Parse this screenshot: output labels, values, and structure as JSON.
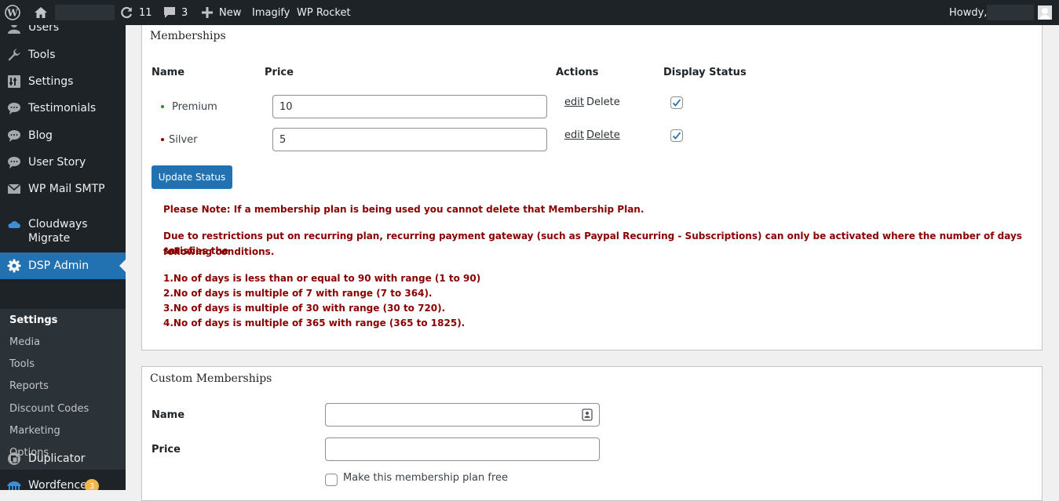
{
  "adminbar": {
    "updates_count": "11",
    "comments_count": "3",
    "new_label": "New",
    "imagify_label": "Imagify",
    "wp_rocket_label": "WP Rocket",
    "howdy_label": "Howdy,"
  },
  "sidebar": {
    "items": [
      {
        "label": "Users",
        "icon": "users-icon"
      },
      {
        "label": "Tools",
        "icon": "wrench-icon"
      },
      {
        "label": "Settings",
        "icon": "settings-icon"
      },
      {
        "label": "Testimonials",
        "icon": "comment-icon"
      },
      {
        "label": "Blog",
        "icon": "comment-icon"
      },
      {
        "label": "User Story",
        "icon": "comment-icon"
      },
      {
        "label": "WP Mail SMTP",
        "icon": "mail-icon"
      },
      {
        "label": "Cloudways",
        "label2": "Migrate",
        "icon": "cloud-icon"
      },
      {
        "label": "DSP Admin",
        "icon": "gear-icon"
      },
      {
        "label": "Duplicator",
        "icon": "duplicator-icon"
      },
      {
        "label": "Wordfence",
        "icon": "wordfence-icon",
        "badge": "3"
      }
    ],
    "submenu": [
      "Settings",
      "Media",
      "Tools",
      "Reports",
      "Discount Codes",
      "Marketing",
      "Options"
    ]
  },
  "memberships": {
    "title": "Memberships",
    "columns": {
      "name": "Name",
      "price": "Price",
      "actions": "Actions",
      "display_status": "Display Status"
    },
    "rows": [
      {
        "name": "Premium",
        "price": "10",
        "edit": "edit",
        "delete": "Delete",
        "displayed": true,
        "bullet_color": "#2e8b2e"
      },
      {
        "name": "Silver",
        "price": "5",
        "edit": "edit",
        "delete": "Delete",
        "displayed": true,
        "bullet_color": "#8a0000"
      }
    ],
    "update_button": "Update Status",
    "notes": {
      "note1": "Please Note: If a membership plan is being used you cannot delete that Membership Plan.",
      "note2_line1": "Due to restrictions put on recurring plan, recurring payment gateway (such as Paypal Recurring - Subscriptions) can only be activated where the number of days satisfies the",
      "note2_line2": "following conditions.",
      "conditions": [
        "1.No of days is less than or equal to 90 with range (1 to 90)",
        "2.No of days is multiple of 7 with range (7 to 364).",
        "3.No of days is multiple of 30 with range (30 to 720).",
        "4.No of days is multiple of 365 with range (365 to 1825)."
      ]
    }
  },
  "custom_memberships": {
    "title": "Custom Memberships",
    "name_label": "Name",
    "name_value": "",
    "price_label": "Price",
    "price_value": "",
    "free_label": "Make this membership plan free"
  },
  "colors": {
    "admin_dark": "#1d2327",
    "accent_blue": "#2271b1",
    "note_red": "#8a0000",
    "badge_orange": "#f0b849"
  }
}
